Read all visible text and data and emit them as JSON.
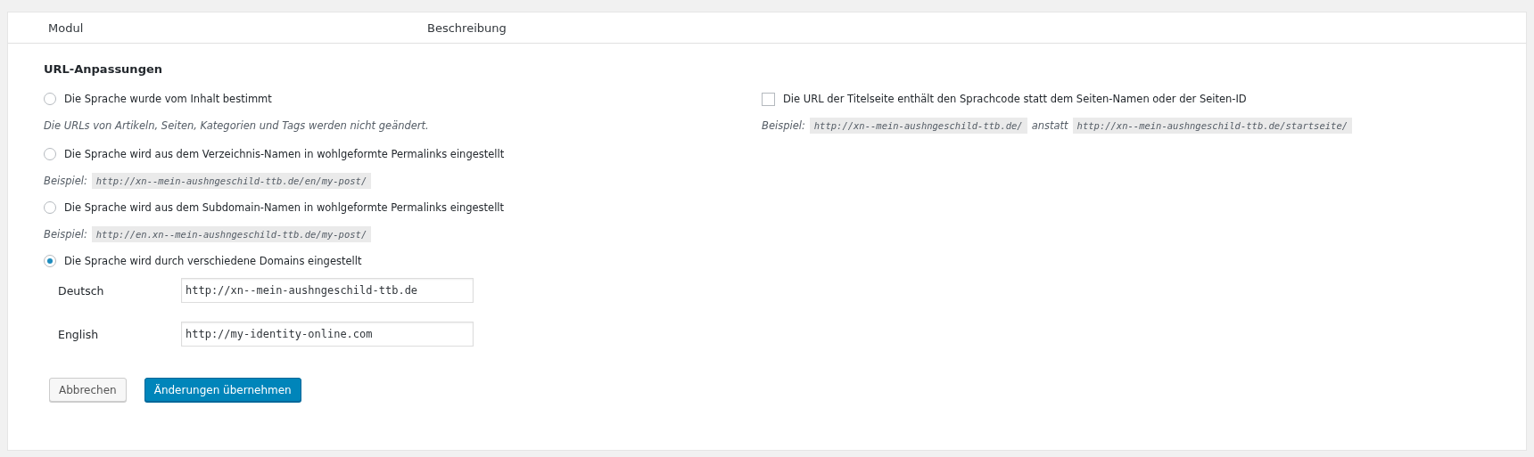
{
  "table": {
    "columns": [
      "Modul",
      "Beschreibung"
    ]
  },
  "section": {
    "title": "URL-Anpassungen",
    "options": [
      {
        "label": "Die Sprache wurde vom Inhalt bestimmt",
        "selected": false,
        "note": "Die URLs von Artikeln, Seiten, Kategorien und Tags werden nicht geändert."
      },
      {
        "label": "Die Sprache wird aus dem Verzeichnis-Namen in wohlgeformte Permalinks eingestellt",
        "selected": false,
        "example": {
          "prefix": "Beispiel:",
          "code": "http://xn--mein-aushngeschild-ttb.de/en/my-post/"
        }
      },
      {
        "label": "Die Sprache wird aus dem Subdomain-Namen in wohlgeformte Permalinks eingestellt",
        "selected": false,
        "example": {
          "prefix": "Beispiel:",
          "code": "http://en.xn--mein-aushngeschild-ttb.de/my-post/"
        }
      },
      {
        "label": "Die Sprache wird durch verschiedene Domains eingestellt",
        "selected": true
      }
    ],
    "domains": [
      {
        "language": "Deutsch",
        "value": "http://xn--mein-aushngeschild-ttb.de"
      },
      {
        "language": "English",
        "value": "http://my-identity-online.com"
      }
    ],
    "home_option": {
      "label": "Die URL der Titelseite enthält den Sprachcode statt dem Seiten-Namen oder der Seiten-ID",
      "checked": false,
      "example": {
        "prefix": "Beispiel:",
        "code": "http://xn--mein-aushngeschild-ttb.de/",
        "connector": "anstatt",
        "alt_code": "http://xn--mein-aushngeschild-ttb.de/startseite/"
      }
    }
  },
  "buttons": [
    {
      "label": "Abbrechen",
      "kind": "secondary"
    },
    {
      "label": "Änderungen übernehmen",
      "kind": "primary"
    }
  ]
}
